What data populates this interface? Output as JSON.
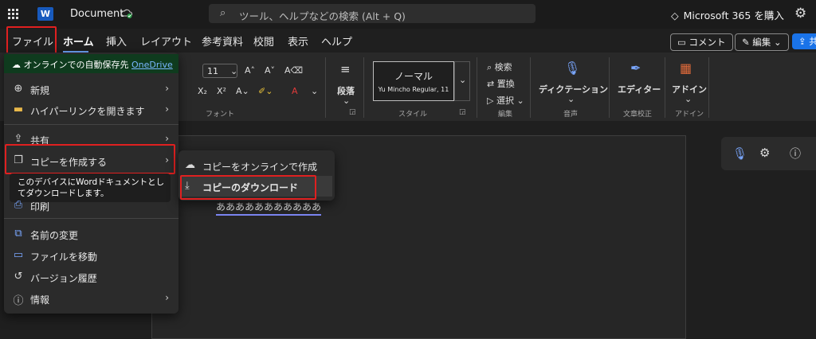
{
  "app": {
    "doc_title": "Document",
    "search_placeholder": "ツール、ヘルプなどの検索 (Alt + Q)",
    "m365": "Microsoft 365 を購入",
    "word_logo": "W"
  },
  "tabs": [
    "ファイル",
    "ホーム",
    "挿入",
    "レイアウト",
    "参考資料",
    "校閲",
    "表示",
    "ヘルプ"
  ],
  "actions": {
    "comment": "コメント",
    "edit": "編集",
    "share": "共"
  },
  "ribbon": {
    "font_size": "11",
    "font_group": "フォント",
    "paragraph": "段落",
    "style_name": "ノーマル",
    "style_font": "Yu Mincho Regular, 11",
    "style_group": "スタイル",
    "find": "検索",
    "replace": "置換",
    "select": "選択",
    "edit_group": "編集",
    "dictation": "ディクテーション",
    "voice_group": "音声",
    "editor": "エディター",
    "proof_group": "文章校正",
    "addins": "アドイン",
    "addins_group": "アドイン"
  },
  "document": {
    "text": "あああああああああああ"
  },
  "file_menu": {
    "autosave_text": "オンラインでの自動保存先",
    "autosave_link": "OneDrive",
    "items": [
      {
        "label": "新規",
        "icon": "plus-circle-icon",
        "submenu": true
      },
      {
        "label": "ハイパーリンクを開きます",
        "icon": "folder-icon",
        "submenu": true
      },
      {
        "label": "共有",
        "icon": "share-icon",
        "submenu": true
      },
      {
        "label": "コピーを作成する",
        "icon": "copy-icon",
        "submenu": true
      },
      {
        "label": "印刷",
        "icon": "printer-icon",
        "submenu": false
      },
      {
        "label": "名前の変更",
        "icon": "rename-icon",
        "submenu": false
      },
      {
        "label": "ファイルを移動",
        "icon": "folder-move-icon",
        "submenu": false
      },
      {
        "label": "バージョン履歴",
        "icon": "history-icon",
        "submenu": false
      },
      {
        "label": "情報",
        "icon": "info-icon",
        "submenu": true
      }
    ],
    "tooltip": "このデバイスにWordドキュメントとしてダウンロードします。"
  },
  "copy_submenu": {
    "items": [
      {
        "label": "コピーをオンラインで作成",
        "icon": "cloud-add-icon"
      },
      {
        "label": "コピーのダウンロード",
        "icon": "download-icon"
      }
    ]
  },
  "colors": {
    "accent": "#6ea8ff",
    "highlight": "#e02020",
    "autosave_bg": "#0f3b1e"
  }
}
